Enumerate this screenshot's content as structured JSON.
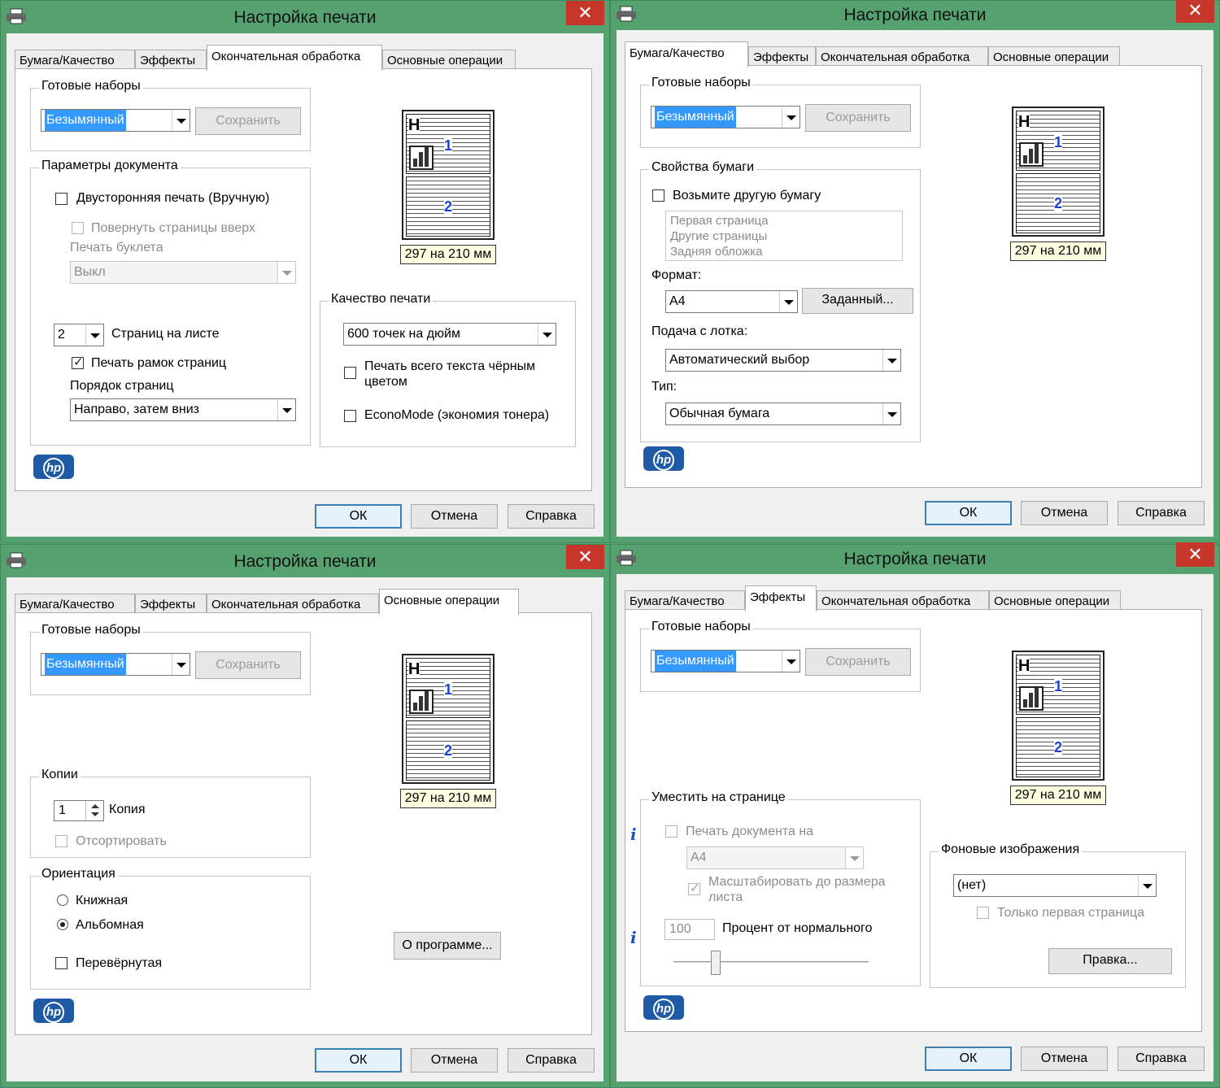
{
  "window_title": "Настройка печати",
  "close_glyph": "✕",
  "tabs": [
    "Бумага/Качество",
    "Эффекты",
    "Окончательная обработка",
    "Основные операции"
  ],
  "presets": {
    "label": "Готовые наборы",
    "value": "Безымянный",
    "save": "Сохранить"
  },
  "preview": {
    "H": "H",
    "page1": "1",
    "page2": "2",
    "size": "297 на 210 мм"
  },
  "buttons": {
    "ok": "ОК",
    "cancel": "Отмена",
    "help": "Справка"
  },
  "logo": "hp",
  "finishing": {
    "doc_params_label": "Параметры документа",
    "duplex": "Двусторонняя печать (Вручную)",
    "flip_up": "Повернуть страницы вверх",
    "booklet_label": "Печать буклета",
    "booklet_value": "Выкл",
    "pages_per_sheet": "2",
    "pages_per_sheet_label": "Страниц на листе",
    "page_borders": "Печать рамок страниц",
    "page_order_label": "Порядок страниц",
    "page_order_value": "Направо, затем вниз",
    "quality_label": "Качество печати",
    "quality_value": "600 точек на дюйм",
    "all_black_1": "Печать всего текста чёрным",
    "all_black_2": "цветом",
    "econo": "EconoMode (экономия тонера)"
  },
  "paper": {
    "props_label": "Свойства бумаги",
    "other_paper": "Возьмите другую бумагу",
    "list": [
      "Первая страница",
      "Другие страницы",
      "Задняя обложка"
    ],
    "format_label": "Формат:",
    "format_value": "A4",
    "custom_btn": "Заданный...",
    "source_label": "Подача с лотка:",
    "source_value": "Автоматический выбор",
    "type_label": "Тип:",
    "type_value": "Обычная бумага"
  },
  "basics": {
    "copies_label": "Копии",
    "copies_value": "1",
    "copies_unit": "Копия",
    "collate": "Отсортировать",
    "orientation_label": "Ориентация",
    "portrait": "Книжная",
    "landscape": "Альбомная",
    "rotated": "Перевёрнутая",
    "about_btn": "О программе..."
  },
  "effects": {
    "fit_label": "Уместить на странице",
    "print_on": "Печать документа на",
    "print_on_value": "A4",
    "scale_fit_1": "Масштабировать до размера",
    "scale_fit_2": "листа",
    "percent_value": "100",
    "percent_label": "Процент от нормального",
    "watermark_label": "Фоновые изображения",
    "watermark_value": "(нет)",
    "first_page_only": "Только первая страница",
    "edit_btn": "Правка...",
    "info_glyph": "i"
  }
}
